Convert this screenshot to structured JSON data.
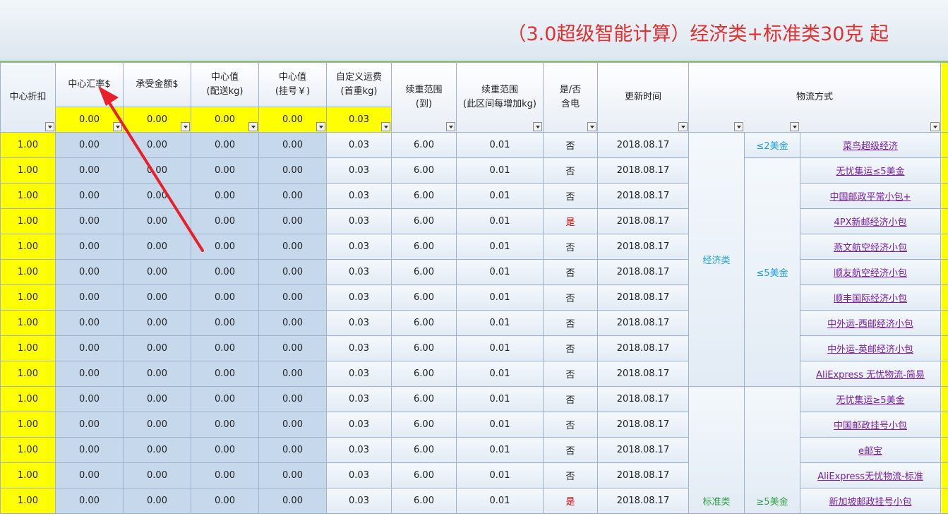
{
  "banner": {
    "title": "（3.0超级智能计算）经济类+标准类30克 起"
  },
  "headers": {
    "discount": "中心折扣",
    "rate": "中心汇率$",
    "accept": "承受金额$",
    "center_send_1": "中心值",
    "center_send_2": "(配送kg)",
    "center_reg_1": "中心值",
    "center_reg_2": "(挂号￥)",
    "custom_1": "自定义运费",
    "custom_2": "(首重kg)",
    "range_to_1": "续重范围",
    "range_to_2": "(到)",
    "range_inc_1": "续重范围",
    "range_inc_2": "(此区间每增加kg)",
    "elec_1": "是/否",
    "elec_2": "含电",
    "update": "更新时间",
    "logistics": "物流方式"
  },
  "header_values": {
    "rate": "0.00",
    "accept": "0.00",
    "center_send": "0.00",
    "center_reg": "0.00",
    "custom": "0.03"
  },
  "groups": {
    "economy": "经济类",
    "standard": "标准类",
    "le2": "≤2美金",
    "le5": "≤5美金",
    "ge5": "≥5美金"
  },
  "rows": [
    {
      "d": "1.00",
      "rate": "0.00",
      "acc": "0.00",
      "send": "0.00",
      "reg": "0.00",
      "cust": "0.03",
      "to": "6.00",
      "inc": "0.01",
      "elec": "否",
      "date": "2018.08.17",
      "name": "菜鸟超级经济"
    },
    {
      "d": "1.00",
      "rate": "0.00",
      "acc": "0.00",
      "send": "0.00",
      "reg": "0.00",
      "cust": "0.03",
      "to": "6.00",
      "inc": "0.01",
      "elec": "否",
      "date": "2018.08.17",
      "name": "无忧集运≤5美金"
    },
    {
      "d": "1.00",
      "rate": "0.00",
      "acc": "0.00",
      "send": "0.00",
      "reg": "0.00",
      "cust": "0.03",
      "to": "6.00",
      "inc": "0.01",
      "elec": "否",
      "date": "2018.08.17",
      "name": "中国邮政平常小包+"
    },
    {
      "d": "1.00",
      "rate": "0.00",
      "acc": "0.00",
      "send": "0.00",
      "reg": "0.00",
      "cust": "0.03",
      "to": "6.00",
      "inc": "0.01",
      "elec": "是",
      "date": "2018.08.17",
      "name": "4PX新邮经济小包"
    },
    {
      "d": "1.00",
      "rate": "0.00",
      "acc": "0.00",
      "send": "0.00",
      "reg": "0.00",
      "cust": "0.03",
      "to": "6.00",
      "inc": "0.01",
      "elec": "否",
      "date": "2018.08.17",
      "name": "燕文航空经济小包"
    },
    {
      "d": "1.00",
      "rate": "0.00",
      "acc": "0.00",
      "send": "0.00",
      "reg": "0.00",
      "cust": "0.03",
      "to": "6.00",
      "inc": "0.01",
      "elec": "否",
      "date": "2018.08.17",
      "name": "顺友航空经济小包"
    },
    {
      "d": "1.00",
      "rate": "0.00",
      "acc": "0.00",
      "send": "0.00",
      "reg": "0.00",
      "cust": "0.03",
      "to": "6.00",
      "inc": "0.01",
      "elec": "否",
      "date": "2018.08.17",
      "name": "顺丰国际经济小包"
    },
    {
      "d": "1.00",
      "rate": "0.00",
      "acc": "0.00",
      "send": "0.00",
      "reg": "0.00",
      "cust": "0.03",
      "to": "6.00",
      "inc": "0.01",
      "elec": "否",
      "date": "2018.08.17",
      "name": "中外运-西邮经济小包"
    },
    {
      "d": "1.00",
      "rate": "0.00",
      "acc": "0.00",
      "send": "0.00",
      "reg": "0.00",
      "cust": "0.03",
      "to": "6.00",
      "inc": "0.01",
      "elec": "否",
      "date": "2018.08.17",
      "name": "中外运-英邮经济小包"
    },
    {
      "d": "1.00",
      "rate": "0.00",
      "acc": "0.00",
      "send": "0.00",
      "reg": "0.00",
      "cust": "0.03",
      "to": "6.00",
      "inc": "0.01",
      "elec": "否",
      "date": "2018.08.17",
      "name": "AliExpress 无忧物流-简易"
    },
    {
      "d": "1.00",
      "rate": "0.00",
      "acc": "0.00",
      "send": "0.00",
      "reg": "0.00",
      "cust": "0.03",
      "to": "6.00",
      "inc": "0.01",
      "elec": "否",
      "date": "2018.08.17",
      "name": "无忧集运≥5美金"
    },
    {
      "d": "1.00",
      "rate": "0.00",
      "acc": "0.00",
      "send": "0.00",
      "reg": "0.00",
      "cust": "0.03",
      "to": "6.00",
      "inc": "0.01",
      "elec": "否",
      "date": "2018.08.17",
      "name": "中国邮政挂号小包"
    },
    {
      "d": "1.00",
      "rate": "0.00",
      "acc": "0.00",
      "send": "0.00",
      "reg": "0.00",
      "cust": "0.03",
      "to": "6.00",
      "inc": "0.01",
      "elec": "否",
      "date": "2018.08.17",
      "name": "e邮宝"
    },
    {
      "d": "1.00",
      "rate": "0.00",
      "acc": "0.00",
      "send": "0.00",
      "reg": "0.00",
      "cust": "0.03",
      "to": "6.00",
      "inc": "0.01",
      "elec": "否",
      "date": "2018.08.17",
      "name": "AliExpress无忧物流-标准"
    },
    {
      "d": "1.00",
      "rate": "0.00",
      "acc": "0.00",
      "send": "0.00",
      "reg": "0.00",
      "cust": "0.03",
      "to": "6.00",
      "inc": "0.01",
      "elec": "是",
      "date": "2018.08.17",
      "name": "新加坡邮政挂号小包"
    }
  ],
  "colors": {
    "yellow": "#ffff00",
    "blue_cell": "#c6d9ec",
    "title_red": "#e23030",
    "arrow": "#e8202a",
    "link": "#7a1fa2",
    "group_text": "#1aa0d8"
  }
}
